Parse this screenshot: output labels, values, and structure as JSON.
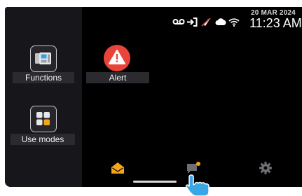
{
  "sidebar": {
    "functions_label": "Functions",
    "use_modes_label": "Use modes"
  },
  "main": {
    "alert_label": "Alert",
    "alert_color": "#e8443a"
  },
  "status_bar": {
    "date": "20 MAR 2024",
    "time": "11:23 AM",
    "icons": [
      "voicemail-icon",
      "sign-in-icon",
      "mic-off-icon",
      "cloud-icon",
      "wifi-icon"
    ]
  },
  "bottom_nav": {
    "items": [
      "home-icon",
      "messages-icon",
      "settings-icon"
    ],
    "accent": "#f5a51a",
    "notification_dot": true
  }
}
